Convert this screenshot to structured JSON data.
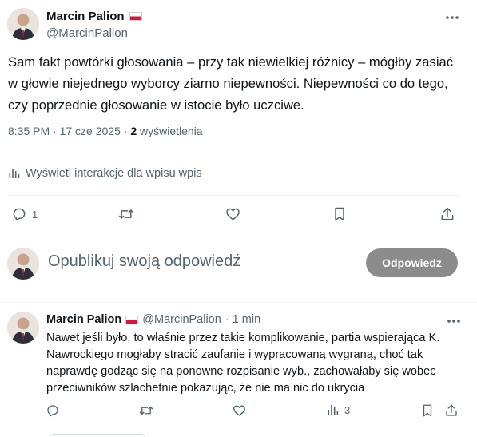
{
  "main_post": {
    "author": {
      "name": "Marcin Palion",
      "handle": "@MarcinPalion",
      "flag": "poland-flag-icon"
    },
    "text": "Sam fakt powtórki głosowania – przy tak niewielkiej różnicy – mógłby zasiać w głowie niejednego wyborcy ziarno niepewności. Niepewności co do tego, czy poprzednie głosowanie w istocie było uczciwe.",
    "timestamp": "8:35 PM · 17 cze 2025 · ",
    "views_count": "2",
    "views_label": "wyświetlenia",
    "analytics_label": "Wyświetl interakcje dla wpisu wpis",
    "actions": {
      "replies": "1",
      "reposts": "",
      "likes": "",
      "bookmark": "",
      "share": ""
    }
  },
  "reply_box": {
    "placeholder": "Opublikuj swoją odpowiedź",
    "button_label": "Odpowiedz"
  },
  "reply_post": {
    "author": {
      "name": "Marcin Palion",
      "handle": "@MarcinPalion",
      "time": "· 1 min"
    },
    "text": "Nawet jeśli było, to właśnie przez takie komplikowanie, partia wspierająca K. Nawrockiego mogłaby stracić zaufanie i wypracowaną wygraną, choć tak naprawdę godząc się na ponowne rozpisanie wyb., zachowałaby się wobec przeciwników szlachetnie pokazując, że nie ma nic do ukrycia",
    "actions": {
      "replies": "",
      "reposts": "",
      "likes": "",
      "views": "3"
    }
  },
  "colors": {
    "text": "#0f1419",
    "muted": "#536471",
    "divider": "#eff3f4",
    "reply_button": "#8c8c8c",
    "flag_red": "#dc143c"
  }
}
